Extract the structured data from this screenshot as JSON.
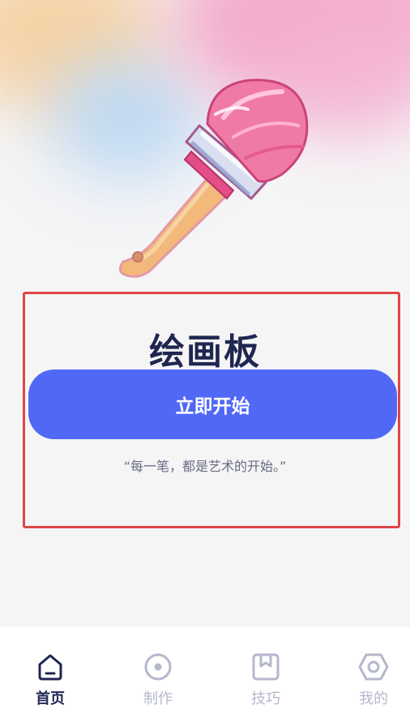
{
  "hero": {
    "title": "绘画板",
    "start_button_label": "立即开始",
    "quote": "“每一笔，都是艺术的开始。”"
  },
  "tabbar": {
    "tabs": [
      {
        "label": "首页",
        "icon": "home-icon",
        "active": true
      },
      {
        "label": "制作",
        "icon": "record-icon",
        "active": false
      },
      {
        "label": "技巧",
        "icon": "bookmark-icon",
        "active": false
      },
      {
        "label": "我的",
        "icon": "hexagon-settings-icon",
        "active": false
      }
    ]
  },
  "colors": {
    "accent": "#5168f7",
    "title": "#1f2650",
    "inactive_tab": "#b5b8cc",
    "highlight_border": "#e14545"
  }
}
